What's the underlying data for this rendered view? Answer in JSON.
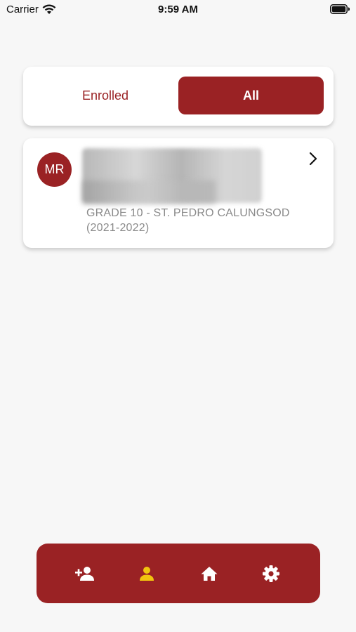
{
  "status_bar": {
    "carrier": "Carrier",
    "time": "9:59 AM"
  },
  "segment": {
    "enrolled_label": "Enrolled",
    "all_label": "All",
    "selected": "All"
  },
  "students": [
    {
      "initials": "MR",
      "grade": "GRADE 10 - ST. PEDRO CALUNGSOD (2021-2022)"
    }
  ],
  "bottom_nav": {
    "items": [
      {
        "icon": "add-person-icon",
        "active": false
      },
      {
        "icon": "person-icon",
        "active": true
      },
      {
        "icon": "home-icon",
        "active": false
      },
      {
        "icon": "gear-icon",
        "active": false
      }
    ]
  },
  "colors": {
    "accent": "#9a2224",
    "active_icon": "#f1c40f",
    "background": "#f7f7f7"
  }
}
